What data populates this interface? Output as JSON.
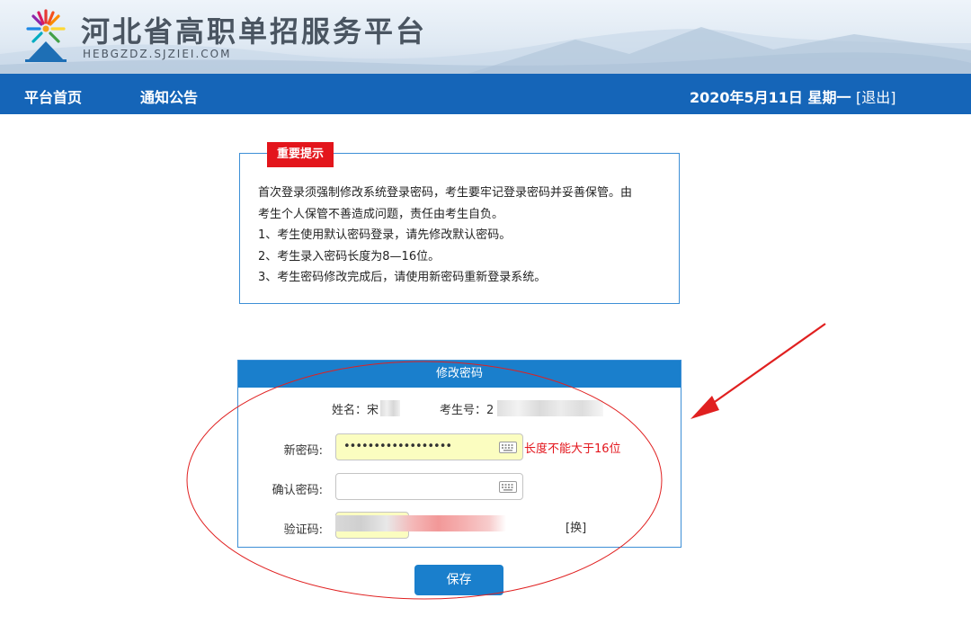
{
  "header": {
    "title": "河北省高职单招服务平台",
    "domain": "HEBGZDZ.SJZIEI.COM"
  },
  "nav": {
    "home": "平台首页",
    "notice": "通知公告",
    "date": "2020年5月11日 星期一",
    "logout": "[退出]"
  },
  "notice": {
    "tag": "重要提示",
    "lines": [
      "首次登录须强制修改系统登录密码，考生要牢记登录密码并妥善保管。由",
      "考生个人保管不善造成问题，责任由考生自负。",
      "1、考生使用默认密码登录，请先修改默认密码。",
      "2、考生录入密码长度为8—16位。",
      "3、考生密码修改完成后，请使用新密码重新登录系统。"
    ]
  },
  "form": {
    "title": "修改密码",
    "name_label": "姓名：宋",
    "id_label": "考生号：2",
    "new_password_label": "新密码:",
    "new_password_value": "••••••••••••••••••",
    "confirm_password_label": "确认密码:",
    "captcha_label": "验证码:",
    "error_text": "长度不能大于16位",
    "refresh_label": "[换]",
    "save_label": "保存"
  },
  "colors": {
    "nav_bg": "#1565b8",
    "panel_head": "#1a7fcc",
    "tag_red": "#e3151c",
    "annotation_red": "#e02020"
  },
  "icons": [
    "logo-icon",
    "keyboard-icon",
    "arrow-annotation-icon"
  ]
}
